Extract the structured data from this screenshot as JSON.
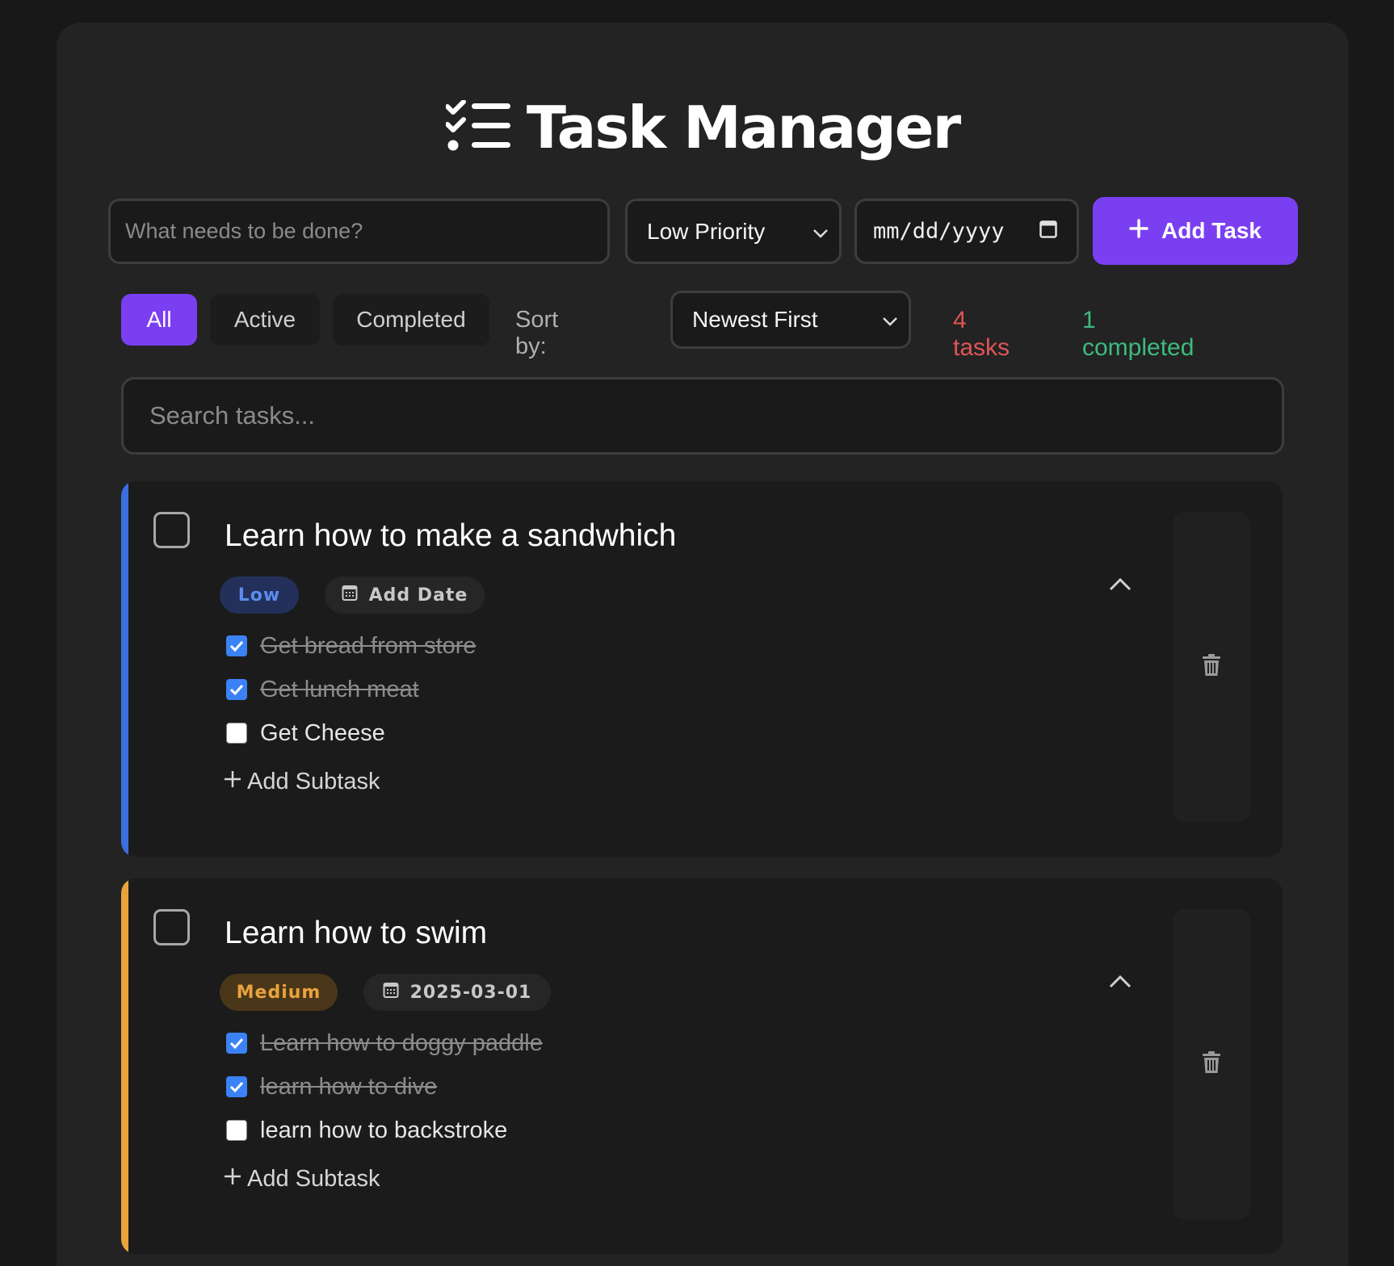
{
  "header": {
    "title": "Task Manager",
    "icon": "checklist-icon"
  },
  "new_task": {
    "placeholder": "What needs to be done?",
    "priority_value": "Low Priority",
    "date_placeholder": "mm/dd/yyyy",
    "add_label": "Add Task"
  },
  "filters": {
    "all": "All",
    "active": "Active",
    "completed": "Completed",
    "selected": "All"
  },
  "sort": {
    "label": "Sort by:",
    "value": "Newest First"
  },
  "stats": {
    "tasks": "4 tasks",
    "completed": "1 completed"
  },
  "search": {
    "placeholder": "Search tasks..."
  },
  "colors": {
    "accent": "#7b3ff2",
    "low": "#3b6fe0",
    "medium": "#e8a33d",
    "tasks_count": "#e05555",
    "completed_count": "#3dbb7e",
    "checkbox": "#3b82f6"
  },
  "tasks": [
    {
      "title": "Learn how to make a sandwhich",
      "priority": "Low",
      "date_label": "Add Date",
      "subtasks": [
        {
          "text": "Get bread from store",
          "done": true
        },
        {
          "text": "Get lunch meat",
          "done": true
        },
        {
          "text": "Get Cheese",
          "done": false
        }
      ],
      "add_subtask": "Add Subtask"
    },
    {
      "title": "Learn how to swim",
      "priority": "Medium",
      "date_label": "2025-03-01",
      "subtasks": [
        {
          "text": "Learn how to doggy paddle",
          "done": true
        },
        {
          "text": "learn how to dive",
          "done": true
        },
        {
          "text": "learn how to backstroke",
          "done": false
        }
      ],
      "add_subtask": "Add Subtask"
    }
  ]
}
